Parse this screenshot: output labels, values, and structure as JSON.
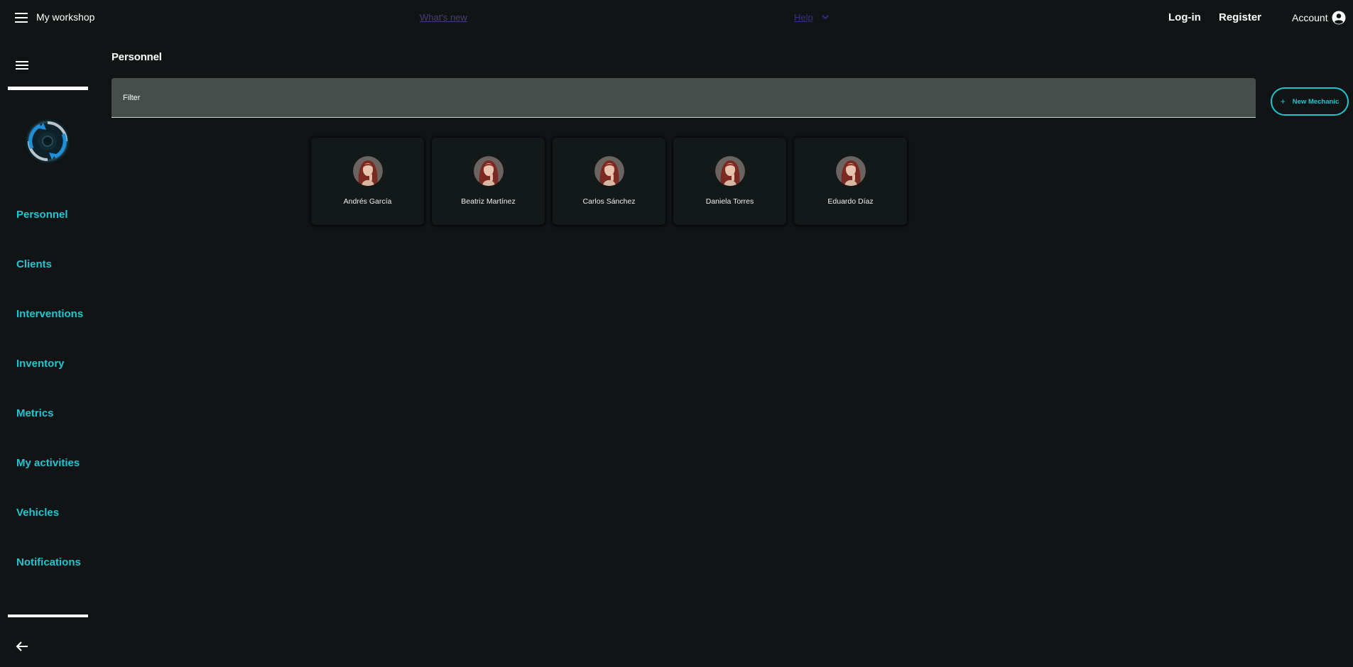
{
  "header": {
    "app_title": "My workshop",
    "whats_new": "What's new",
    "help": "Help",
    "login": "Log-in",
    "register": "Register",
    "account": "Account"
  },
  "sidebar": {
    "items": [
      {
        "label": "Personnel"
      },
      {
        "label": "Clients"
      },
      {
        "label": "Interventions"
      },
      {
        "label": "Inventory"
      },
      {
        "label": "Metrics"
      },
      {
        "label": "My activities"
      },
      {
        "label": "Vehicles"
      },
      {
        "label": "Notifications"
      }
    ]
  },
  "main": {
    "title": "Personnel",
    "filter_placeholder": "Filter",
    "new_button": "New Mechanic",
    "mechanics": [
      {
        "name": "Andrés García"
      },
      {
        "name": "Beatriz Martínez"
      },
      {
        "name": "Carlos Sánchez"
      },
      {
        "name": "Daniela Torres"
      },
      {
        "name": "Eduardo Díaz"
      }
    ]
  },
  "colors": {
    "background": "#101415",
    "accent": "#1fc6d0",
    "filter_bg": "#464e4c",
    "card_bg": "#131818"
  },
  "icons": {
    "menu": "menu-icon",
    "help_caret": "chevron-down-icon",
    "account": "account-circle-icon",
    "logo": "workshop-logo",
    "back": "arrow-left-icon",
    "add": "plus-icon",
    "avatar": "avatar-photo"
  }
}
